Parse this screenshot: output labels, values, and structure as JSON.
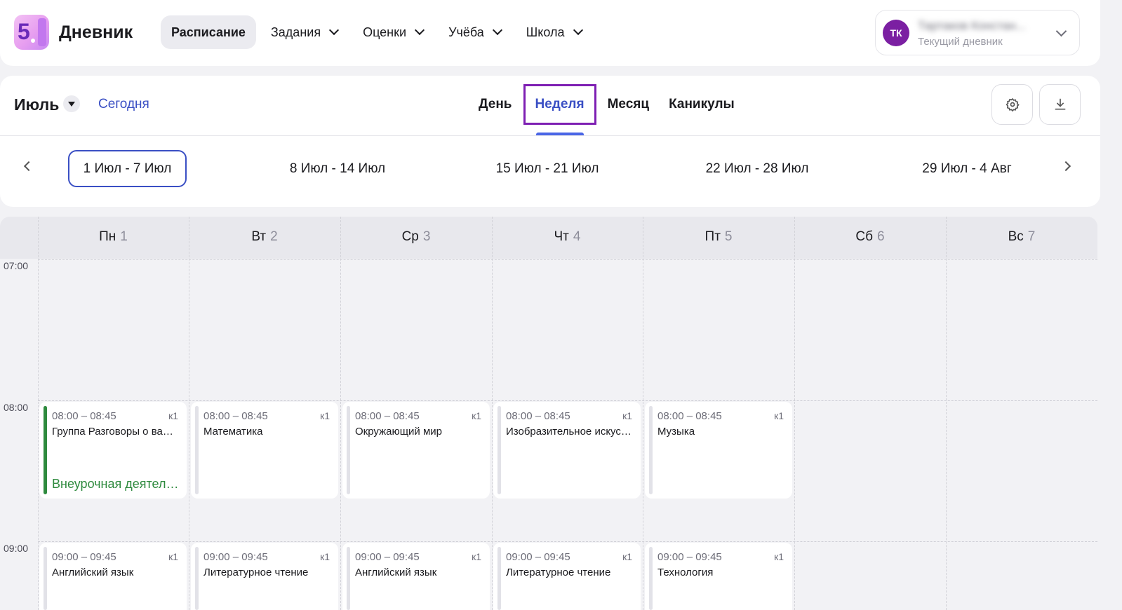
{
  "header": {
    "logo_digit": "5",
    "brand": "Дневник",
    "nav": [
      {
        "label": "Расписание",
        "active": true,
        "dropdown": false
      },
      {
        "label": "Задания",
        "active": false,
        "dropdown": true
      },
      {
        "label": "Оценки",
        "active": false,
        "dropdown": true
      },
      {
        "label": "Учёба",
        "active": false,
        "dropdown": true
      },
      {
        "label": "Школа",
        "active": false,
        "dropdown": true
      }
    ],
    "profile": {
      "initials": "ТК",
      "name": "Тартаков Констан...",
      "subtitle": "Текущий дневник",
      "avatar_color": "#7b1fa2"
    }
  },
  "toolbar": {
    "month": "Июль",
    "today": "Сегодня",
    "views": [
      "День",
      "Неделя",
      "Месяц",
      "Каникулы"
    ],
    "active_view": "Неделя",
    "settings_icon": "gear-icon",
    "download_icon": "download-icon"
  },
  "weeks": [
    {
      "label": "1 Июл - 7 Июл",
      "active": true
    },
    {
      "label": "8 Июл - 14 Июл",
      "active": false
    },
    {
      "label": "15 Июл - 21 Июл",
      "active": false
    },
    {
      "label": "22 Июл - 28 Июл",
      "active": false
    },
    {
      "label": "29 Июл - 4 Авг",
      "active": false
    }
  ],
  "calendar": {
    "days": [
      {
        "name": "Пн",
        "num": "1"
      },
      {
        "name": "Вт",
        "num": "2"
      },
      {
        "name": "Ср",
        "num": "3"
      },
      {
        "name": "Чт",
        "num": "4"
      },
      {
        "name": "Пт",
        "num": "5"
      },
      {
        "name": "Сб",
        "num": "6"
      },
      {
        "name": "Вс",
        "num": "7"
      }
    ],
    "times": [
      "07:00",
      "08:00",
      "09:00"
    ],
    "events": [
      {
        "day": 0,
        "slot": 1,
        "time": "08:00 – 08:45",
        "room": "к1",
        "subject": "Группа Разговоры о важном",
        "kind": "Внеурочная деятельность",
        "accent": "green"
      },
      {
        "day": 1,
        "slot": 1,
        "time": "08:00 – 08:45",
        "room": "к1",
        "subject": "Математика",
        "kind": "",
        "accent": "grey"
      },
      {
        "day": 2,
        "slot": 1,
        "time": "08:00 – 08:45",
        "room": "к1",
        "subject": "Окружающий мир",
        "kind": "",
        "accent": "grey"
      },
      {
        "day": 3,
        "slot": 1,
        "time": "08:00 – 08:45",
        "room": "к1",
        "subject": "Изобразительное искусство",
        "kind": "",
        "accent": "grey"
      },
      {
        "day": 4,
        "slot": 1,
        "time": "08:00 – 08:45",
        "room": "к1",
        "subject": "Музыка",
        "kind": "",
        "accent": "grey"
      },
      {
        "day": 0,
        "slot": 2,
        "time": "09:00 – 09:45",
        "room": "к1",
        "subject": "Английский язык",
        "kind": "",
        "accent": "grey"
      },
      {
        "day": 1,
        "slot": 2,
        "time": "09:00 – 09:45",
        "room": "к1",
        "subject": "Литературное чтение",
        "kind": "",
        "accent": "grey"
      },
      {
        "day": 2,
        "slot": 2,
        "time": "09:00 – 09:45",
        "room": "к1",
        "subject": "Английский язык",
        "kind": "",
        "accent": "grey"
      },
      {
        "day": 3,
        "slot": 2,
        "time": "09:00 – 09:45",
        "room": "к1",
        "subject": "Литературное чтение",
        "kind": "",
        "accent": "grey"
      },
      {
        "day": 4,
        "slot": 2,
        "time": "09:00 – 09:45",
        "room": "к1",
        "subject": "Технология",
        "kind": "",
        "accent": "grey"
      }
    ]
  }
}
